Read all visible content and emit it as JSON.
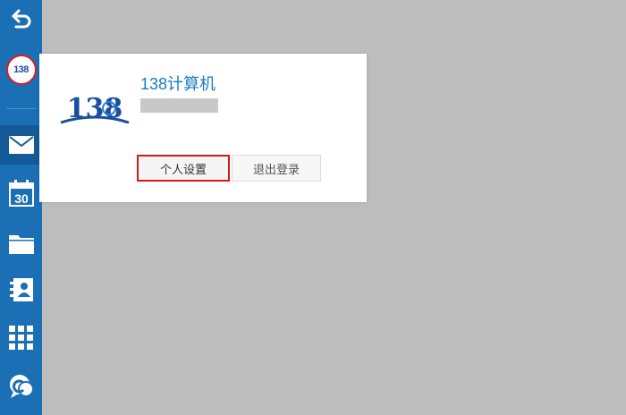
{
  "sidebar": {
    "avatar_text": "138",
    "calendar_day": "30",
    "icons": [
      "back-icon",
      "avatar",
      "mail-icon",
      "calendar-icon",
      "folder-icon",
      "contacts-icon",
      "apps-icon",
      "chat-icon"
    ]
  },
  "popup": {
    "username": "138计算机",
    "logo_text": "138",
    "settings_button": "个人设置",
    "logout_button": "退出登录"
  },
  "colors": {
    "sidebar": "#1a6fb5",
    "accent_text": "#1a7cc0",
    "highlight": "#d31b1b",
    "background": "#bdbdbd"
  }
}
